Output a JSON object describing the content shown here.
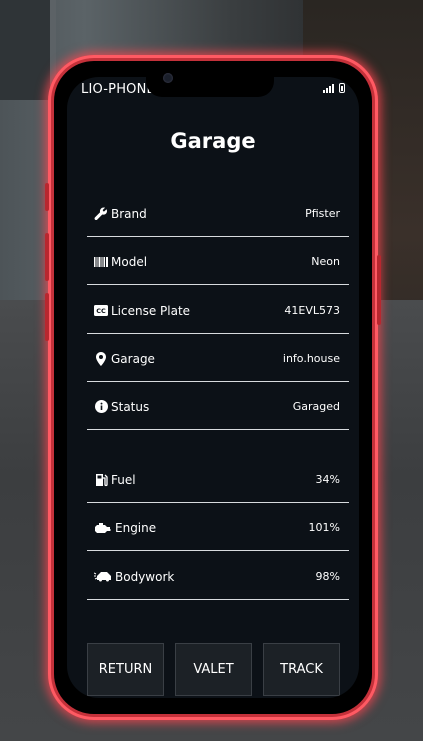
{
  "phone": {
    "brand": "LIO-PHONE"
  },
  "garage": {
    "title": "Garage",
    "vehicle_rows": [
      {
        "icon": "wrench-icon",
        "label": "Brand",
        "value": "Pfister"
      },
      {
        "icon": "barcode-icon",
        "label": "Model",
        "value": "Neon"
      },
      {
        "icon": "cc-icon",
        "label": "License Plate",
        "value": "41EVL573"
      },
      {
        "icon": "location-pin-icon",
        "label": "Garage",
        "value": "info.house"
      },
      {
        "icon": "info-icon",
        "label": "Status",
        "value": "Garaged"
      }
    ],
    "stat_rows": [
      {
        "icon": "gas-pump-icon",
        "label": "Fuel",
        "value": "34%"
      },
      {
        "icon": "engine-icon",
        "label": "Engine",
        "value": "101%"
      },
      {
        "icon": "car-crash-icon",
        "label": "Bodywork",
        "value": "98%"
      }
    ],
    "actions": {
      "return": "RETURN",
      "valet": "VALET",
      "track": "TRACK"
    }
  },
  "colors": {
    "frame": "#c4313a",
    "screen": "#0c1117",
    "divider": "#d8dbde"
  }
}
